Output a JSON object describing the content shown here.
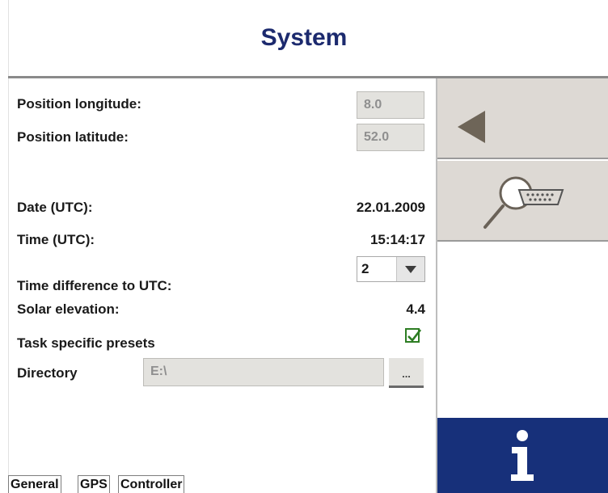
{
  "header": {
    "title": "System"
  },
  "fields": {
    "longitude": {
      "label": "Position longitude:",
      "value": "8.0"
    },
    "latitude": {
      "label": "Position latitude:",
      "value": "52.0"
    },
    "date": {
      "label": "Date (UTC):",
      "value": "22.01.2009"
    },
    "time": {
      "label": "Time (UTC):",
      "value": "15:14:17"
    },
    "time_difference": {
      "label": "Time difference to UTC:",
      "value": "2"
    },
    "solar_elevation": {
      "label": "Solar elevation:",
      "value": "4.4"
    },
    "task_presets": {
      "label": "Task specific presets",
      "checked": true
    },
    "directory": {
      "label": "Directory",
      "value": "E:\\",
      "browse_label": "..."
    }
  },
  "sidebar": {
    "back_icon": "back-arrow-icon",
    "diagnostics_icon": "magnifier-connector-icon",
    "info_icon": "info-icon",
    "info_label": "i"
  },
  "tabs": [
    {
      "label": "General",
      "active": true
    },
    {
      "label": "GPS",
      "active": false
    },
    {
      "label": "Controller",
      "active": false
    }
  ],
  "colors": {
    "title": "#1c2a6e",
    "info_button": "#17307a",
    "side_buttons": "#ddd9d4",
    "checkbox": "#2d7d23"
  }
}
